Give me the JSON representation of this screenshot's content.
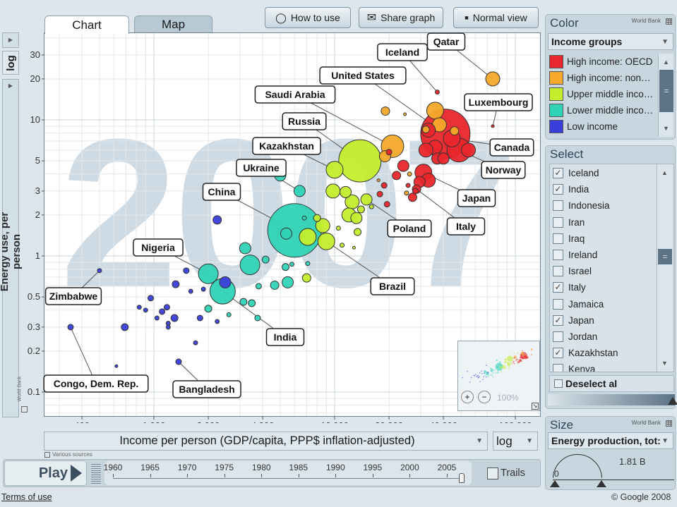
{
  "toolbar": {
    "how_to_use": "How to use",
    "share_graph": "Share graph",
    "normal_view": "Normal view"
  },
  "tabs": [
    {
      "label": "Chart",
      "active": true
    },
    {
      "label": "Map",
      "active": false
    }
  ],
  "y_scale_selector": "log",
  "footer": {
    "terms": "Terms of use",
    "copyright": "© Google 2008",
    "various_sources": "Various sources",
    "world_bank": "World Bank"
  },
  "x_axis_selector": {
    "label": "Income per person (GDP/capita, PPP$ inflation-adjusted)",
    "scale": "log"
  },
  "playbar": {
    "play": "Play",
    "years": [
      "1960",
      "1965",
      "1970",
      "1975",
      "1980",
      "1985",
      "1990",
      "1995",
      "2000",
      "2005"
    ],
    "current_year": 2007,
    "year_min": 1960,
    "year_max": 2007,
    "trails": "Trails",
    "trails_checked": false
  },
  "minimap": {
    "zoom": "100%"
  },
  "color_panel": {
    "title": "Color",
    "source": "World Bank",
    "selector": "Income groups",
    "groups": [
      {
        "label": "High income: OECD",
        "color": "#e8262b"
      },
      {
        "label": "High income: non…",
        "color": "#f6a92a"
      },
      {
        "label": "Upper middle inco…",
        "color": "#c3ef2c"
      },
      {
        "label": "Lower middle inco…",
        "color": "#2fd3b6"
      },
      {
        "label": "Low income",
        "color": "#3a3ed8"
      }
    ]
  },
  "select_panel": {
    "title": "Select",
    "deselect": "Deselect al",
    "items": [
      {
        "label": "Iceland",
        "checked": true
      },
      {
        "label": "India",
        "checked": true
      },
      {
        "label": "Indonesia",
        "checked": false
      },
      {
        "label": "Iran",
        "checked": false
      },
      {
        "label": "Iraq",
        "checked": false
      },
      {
        "label": "Ireland",
        "checked": false
      },
      {
        "label": "Israel",
        "checked": false
      },
      {
        "label": "Italy",
        "checked": true
      },
      {
        "label": "Jamaica",
        "checked": false
      },
      {
        "label": "Japan",
        "checked": true
      },
      {
        "label": "Jordan",
        "checked": false
      },
      {
        "label": "Kazakhstan",
        "checked": true
      },
      {
        "label": "Kenya",
        "checked": false
      }
    ]
  },
  "size_panel": {
    "title": "Size",
    "source": "World Bank",
    "selector": "Energy production, tot:",
    "min_label": "0",
    "max_label": "1.81 B"
  },
  "chart_data": {
    "type": "scatter",
    "year_watermark": "2007",
    "xlabel": "Income per person (GDP/capita, PPP$ inflation-adjusted)",
    "ylabel": "Energy use, per person",
    "x_scale": "log",
    "y_scale": "log",
    "xlim": [
      300,
      120000
    ],
    "ylim": [
      0.08,
      40
    ],
    "x_ticks": [
      {
        "v": 400,
        "t": "400"
      },
      {
        "v": 1000,
        "t": "1 000"
      },
      {
        "v": 2000,
        "t": "2 000"
      },
      {
        "v": 4000,
        "t": "4 000"
      },
      {
        "v": 10000,
        "t": "10 000"
      },
      {
        "v": 20000,
        "t": "20 000"
      },
      {
        "v": 40000,
        "t": "40 000"
      },
      {
        "v": 100000,
        "t": "100 000"
      }
    ],
    "y_ticks": [
      {
        "v": 0.1,
        "t": "0.1"
      },
      {
        "v": 0.2,
        "t": "0.2"
      },
      {
        "v": 0.3,
        "t": "0.3"
      },
      {
        "v": 0.5,
        "t": "0.5"
      },
      {
        "v": 1,
        "t": "1"
      },
      {
        "v": 2,
        "t": "2"
      },
      {
        "v": 3,
        "t": "3"
      },
      {
        "v": 5,
        "t": "5"
      },
      {
        "v": 10,
        "t": "10"
      },
      {
        "v": 20,
        "t": "20"
      },
      {
        "v": 30,
        "t": "30"
      }
    ],
    "grid": true,
    "size_max": 1810,
    "labeled": [
      {
        "name": "Qatar",
        "x": 75000,
        "y": 20,
        "size": 125,
        "group": 1
      },
      {
        "name": "Iceland",
        "x": 37000,
        "y": 16,
        "size": 11,
        "group": 0
      },
      {
        "name": "United States",
        "x": 41000,
        "y": 7.9,
        "size": 1535,
        "group": 0
      },
      {
        "name": "Luxembourg",
        "x": 75000,
        "y": 9.0,
        "size": 5,
        "group": 0
      },
      {
        "name": "Canada",
        "x": 44500,
        "y": 7.3,
        "size": 180,
        "group": 0
      },
      {
        "name": "Norway",
        "x": 48700,
        "y": 6.0,
        "size": 360,
        "group": 0
      },
      {
        "name": "Saudi Arabia",
        "x": 20900,
        "y": 6.4,
        "size": 320,
        "group": 1
      },
      {
        "name": "Russia",
        "x": 13800,
        "y": 5.0,
        "size": 1128,
        "group": 2
      },
      {
        "name": "Kazakhstan",
        "x": 10000,
        "y": 4.3,
        "size": 180,
        "group": 2
      },
      {
        "name": "Ukraine",
        "x": 6400,
        "y": 3.0,
        "size": 80,
        "group": 3
      },
      {
        "name": "China",
        "x": 6000,
        "y": 1.54,
        "size": 1810,
        "group": 3
      },
      {
        "name": "Nigeria",
        "x": 2000,
        "y": 0.74,
        "size": 245,
        "group": 3
      },
      {
        "name": "India",
        "x": 2400,
        "y": 0.55,
        "size": 406,
        "group": 3
      },
      {
        "name": "Zimbabwe",
        "x": 500,
        "y": 0.78,
        "size": 11,
        "group": 4
      },
      {
        "name": "Congo, Dem. Rep.",
        "x": 346,
        "y": 0.3,
        "size": 20,
        "group": 4
      },
      {
        "name": "Bangladesh",
        "x": 1370,
        "y": 0.167,
        "size": 20,
        "group": 4
      },
      {
        "name": "Brazil",
        "x": 9000,
        "y": 1.28,
        "size": 180,
        "group": 2
      },
      {
        "name": "Poland",
        "x": 15000,
        "y": 2.6,
        "size": 80,
        "group": 2
      },
      {
        "name": "Japan",
        "x": 31000,
        "y": 4.1,
        "size": 180,
        "group": 0
      },
      {
        "name": "Italy",
        "x": 28400,
        "y": 3.1,
        "size": 45,
        "group": 0
      }
    ],
    "others": [
      [
        2240,
        1.84,
        45,
        4
      ],
      [
        1510,
        0.78,
        20,
        4
      ],
      [
        1320,
        0.62,
        31,
        4
      ],
      [
        1600,
        0.55,
        11,
        4
      ],
      [
        1880,
        0.57,
        11,
        4
      ],
      [
        1110,
        0.39,
        20,
        4
      ],
      [
        1200,
        0.32,
        11,
        4
      ],
      [
        1180,
        0.42,
        20,
        4
      ],
      [
        1300,
        0.35,
        31,
        4
      ],
      [
        960,
        0.49,
        20,
        4
      ],
      [
        830,
        0.42,
        11,
        4
      ],
      [
        690,
        0.3,
        31,
        4
      ],
      [
        900,
        0.4,
        11,
        4
      ],
      [
        1040,
        0.35,
        11,
        4
      ],
      [
        1700,
        0.23,
        11,
        4
      ],
      [
        620,
        0.155,
        5,
        4
      ],
      [
        1200,
        0.3,
        11,
        4
      ],
      [
        1800,
        0.35,
        20,
        4
      ],
      [
        2240,
        0.33,
        11,
        4
      ],
      [
        2480,
        0.64,
        80,
        4
      ],
      [
        5000,
        3.9,
        80,
        3
      ],
      [
        3200,
        1.14,
        80,
        3
      ],
      [
        3400,
        0.86,
        245,
        3
      ],
      [
        4150,
        0.94,
        31,
        3
      ],
      [
        5350,
        0.83,
        31,
        3
      ],
      [
        4660,
        0.61,
        45,
        3
      ],
      [
        3130,
        0.46,
        31,
        3
      ],
      [
        2000,
        0.41,
        31,
        3
      ],
      [
        2600,
        0.37,
        11,
        3
      ],
      [
        3750,
        0.35,
        20,
        3
      ],
      [
        3480,
        0.45,
        31,
        3
      ],
      [
        5800,
        0.87,
        11,
        3
      ],
      [
        7100,
        0.88,
        11,
        3
      ],
      [
        5500,
        0.64,
        80,
        3
      ],
      [
        3800,
        0.6,
        20,
        3
      ],
      [
        5400,
        1.46,
        80,
        3
      ],
      [
        6800,
        1.9,
        11,
        3
      ],
      [
        9800,
        3.0,
        125,
        2
      ],
      [
        11500,
        2.95,
        80,
        2
      ],
      [
        12500,
        2.5,
        125,
        2
      ],
      [
        12000,
        2.0,
        125,
        2
      ],
      [
        13200,
        1.9,
        80,
        2
      ],
      [
        8600,
        1.67,
        125,
        2
      ],
      [
        14000,
        2.2,
        31,
        2
      ],
      [
        10500,
        1.6,
        11,
        2
      ],
      [
        12800,
        1.15,
        5,
        2
      ],
      [
        7000,
        0.69,
        45,
        2
      ],
      [
        7100,
        1.38,
        180,
        2
      ],
      [
        13400,
        1.5,
        31,
        2
      ],
      [
        8000,
        1.9,
        31,
        2
      ],
      [
        11000,
        1.2,
        11,
        2
      ],
      [
        16000,
        2.3,
        11,
        2
      ],
      [
        19100,
        11.6,
        45,
        1
      ],
      [
        36000,
        11.7,
        180,
        1
      ],
      [
        38000,
        9.2,
        125,
        1
      ],
      [
        24500,
        11.0,
        5,
        1
      ],
      [
        46000,
        8.3,
        45,
        1
      ],
      [
        26000,
        4.0,
        11,
        1
      ],
      [
        25000,
        2.9,
        11,
        1
      ],
      [
        19000,
        5.4,
        80,
        1
      ],
      [
        32000,
        8.5,
        31,
        1
      ],
      [
        17500,
        3.6,
        5,
        1
      ],
      [
        24000,
        4.6,
        80,
        0
      ],
      [
        22000,
        3.9,
        45,
        0
      ],
      [
        29500,
        3.5,
        80,
        0
      ],
      [
        33000,
        3.6,
        125,
        0
      ],
      [
        27000,
        2.7,
        45,
        0
      ],
      [
        25500,
        3.3,
        11,
        0
      ],
      [
        18800,
        3.3,
        20,
        0
      ],
      [
        19500,
        2.4,
        20,
        0
      ],
      [
        17800,
        2.85,
        20,
        0
      ],
      [
        37000,
        5.2,
        80,
        0
      ],
      [
        36000,
        6.3,
        125,
        0
      ],
      [
        33000,
        8.4,
        125,
        0
      ],
      [
        32000,
        6.0,
        125,
        0
      ],
      [
        55000,
        6.0,
        125,
        0
      ],
      [
        40000,
        5.2,
        80,
        0
      ],
      [
        28000,
        3.0,
        20,
        0
      ],
      [
        20000,
        5.8,
        20,
        0
      ]
    ]
  }
}
